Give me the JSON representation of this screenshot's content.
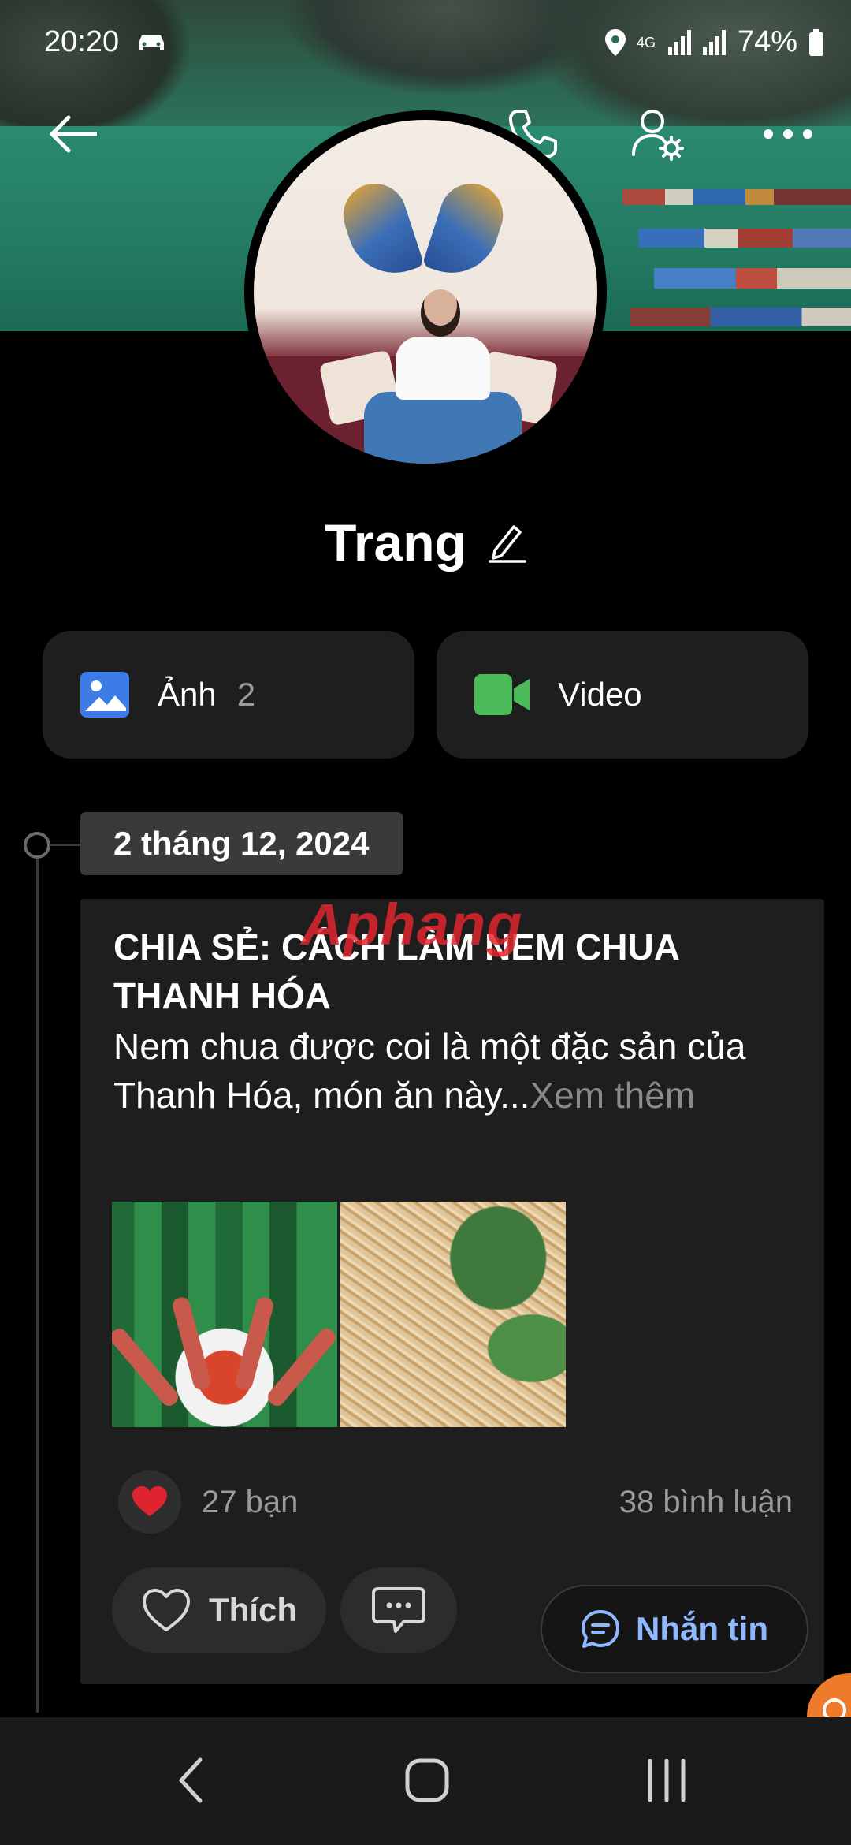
{
  "status_bar": {
    "time": "20:20",
    "network": "4G",
    "battery": "74%"
  },
  "header": {
    "icons": [
      "back-arrow-icon",
      "phone-icon",
      "profile-settings-icon",
      "more-icon"
    ]
  },
  "profile": {
    "name": "Trang"
  },
  "media": {
    "photos_label": "Ảnh",
    "photos_count": "2",
    "video_label": "Video"
  },
  "timeline": {
    "date": "2 tháng 12, 2024"
  },
  "post": {
    "title": "CHIA SẺ: CÁCH LÀM NEM CHUA THANH HÓA",
    "body": "Nem chua được coi là một đặc sản của Thanh Hóa, món ăn này...",
    "more": "Xem thêm",
    "likes": "27 bạn",
    "comments": "38 bình luận",
    "like_label": "Thích"
  },
  "watermark": "Aphang",
  "message_button": "Nhắn tin",
  "colors": {
    "background": "#000000",
    "card": "#1e1e1e",
    "photo_icon": "#3d7be6",
    "video_icon": "#4cbb5a",
    "heart": "#e0242f",
    "message_text": "#8fb8ff"
  }
}
